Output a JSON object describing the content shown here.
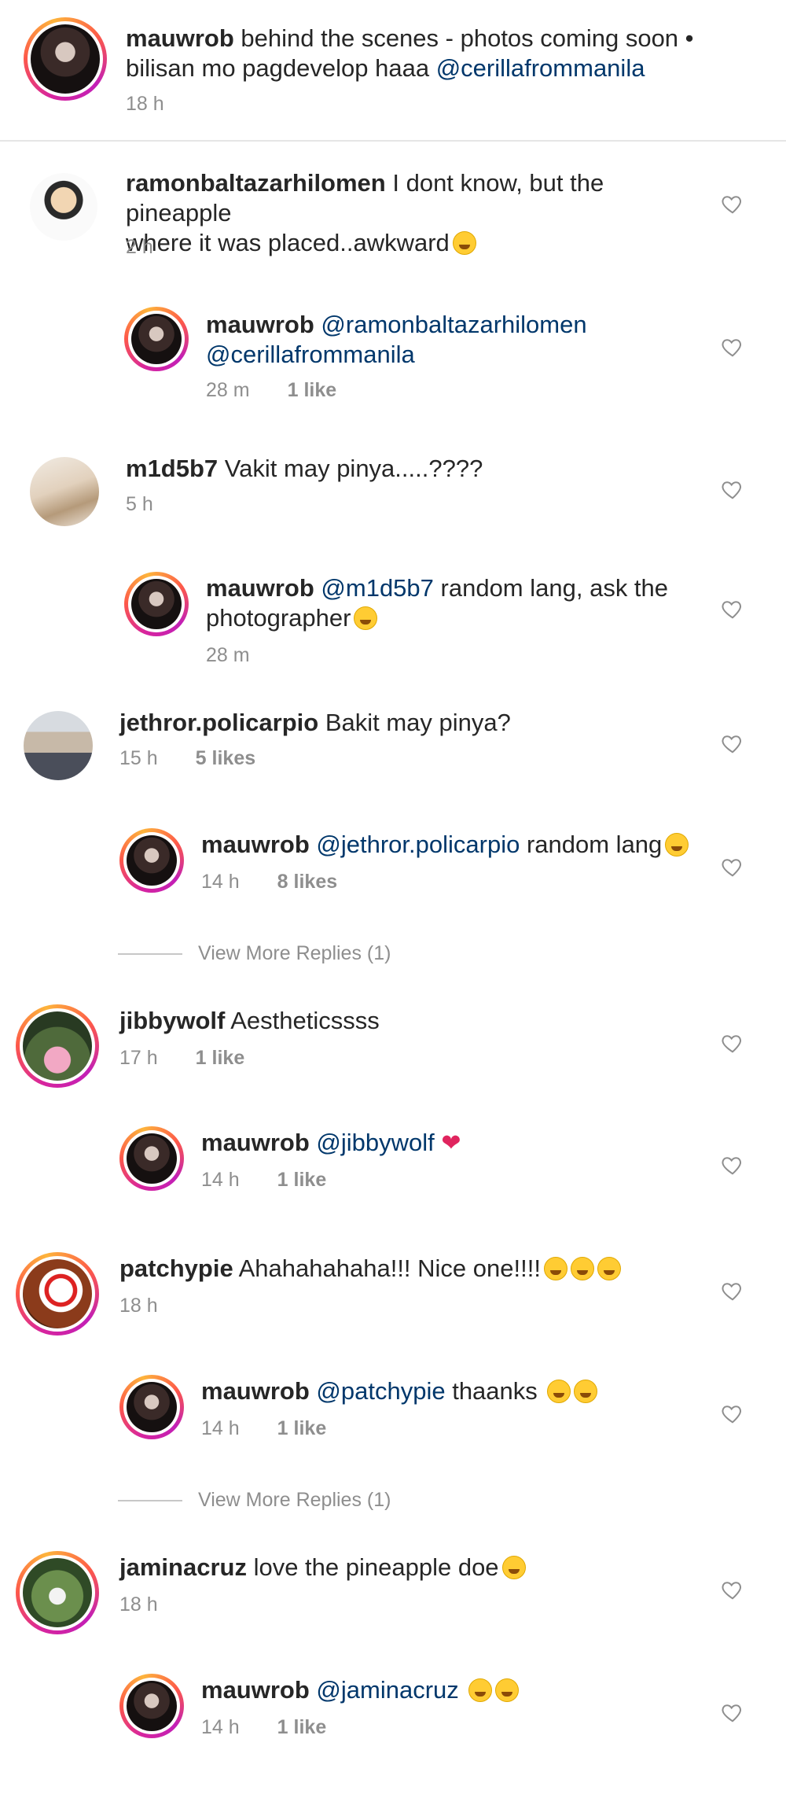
{
  "caption": {
    "username": "mauwrob",
    "text": " behind the scenes - photos coming soon •",
    "text2": "bilisan mo pagdevelop haaa ",
    "mention": "@cerillafrommanila",
    "time": "18 h"
  },
  "comments": [
    {
      "username": "ramonbaltazarhilomen",
      "text": " I dont know, but the pineapple",
      "text2": "where it was placed..awkward",
      "time": "2 h",
      "avatar": "ramon"
    },
    {
      "username": "mauwrob",
      "mention": " @ramonbaltazarhilomen",
      "mention2": "@cerillafrommanila",
      "time": "28 m",
      "likes": "1 like"
    },
    {
      "username": "m1d5b7",
      "text": " Vakit may pinya.....????",
      "time": "5 h"
    },
    {
      "username": "mauwrob",
      "mention": " @m1d5b7",
      "text": " random lang, ask the",
      "text2": "photographer",
      "time": "28 m"
    },
    {
      "username": "jethror.policarpio",
      "text": " Bakit may pinya?",
      "time": "15 h",
      "likes": "5 likes"
    },
    {
      "username": "mauwrob",
      "mention": " @jethror.policarpio",
      "text": " random lang",
      "time": "14 h",
      "likes": "8 likes"
    },
    {
      "username": "jibbywolf",
      "text": " Aestheticssss",
      "time": "17 h",
      "likes": "1 like"
    },
    {
      "username": "mauwrob",
      "mention": " @jibbywolf",
      "time": "14 h",
      "likes": "1 like"
    },
    {
      "username": "patchypie",
      "text": " Ahahahahaha!!! Nice one!!!!",
      "time": "18 h"
    },
    {
      "username": "mauwrob",
      "mention": " @patchypie",
      "text": " thaanks",
      "time": "14 h",
      "likes": "1 like"
    },
    {
      "username": "jaminacruz",
      "text": " love the pineapple doe",
      "time": "18 h"
    },
    {
      "username": "mauwrob",
      "mention": " @jaminacruz",
      "time": "14 h",
      "likes": "1 like"
    }
  ],
  "view_more_1": "View More Replies (1)",
  "view_more_2": "View More Replies (1)",
  "icons": {
    "like": "heart-outline-icon"
  }
}
